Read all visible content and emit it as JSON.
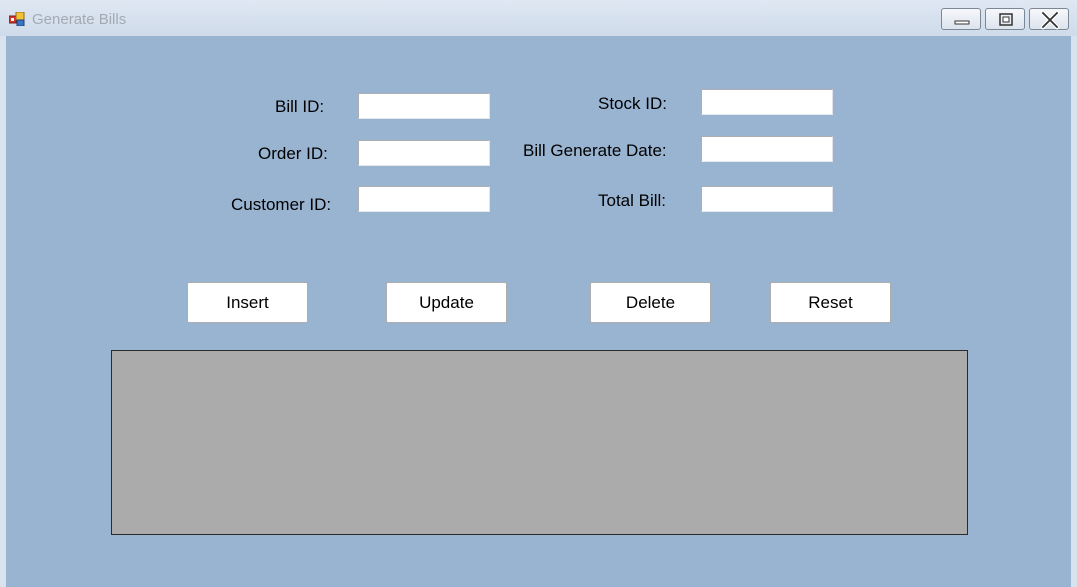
{
  "window": {
    "title": "Generate Bills",
    "app_icon": "app-form-icon",
    "controls": {
      "minimize_icon": "minimize-icon",
      "maximize_icon": "maximize-icon",
      "close_icon": "close-icon"
    }
  },
  "form": {
    "bill_id": {
      "label": "Bill ID:",
      "value": ""
    },
    "order_id": {
      "label": "Order ID:",
      "value": ""
    },
    "customer_id": {
      "label": "Customer ID:",
      "value": ""
    },
    "stock_id": {
      "label": "Stock ID:",
      "value": ""
    },
    "bill_generate_date": {
      "label": "Bill Generate Date:",
      "value": ""
    },
    "total_bill": {
      "label": "Total Bill:",
      "value": ""
    }
  },
  "buttons": {
    "insert": "Insert",
    "update": "Update",
    "delete": "Delete",
    "reset": "Reset"
  },
  "colors": {
    "client_background": "#99b4d1",
    "grid_background": "#ababab"
  }
}
